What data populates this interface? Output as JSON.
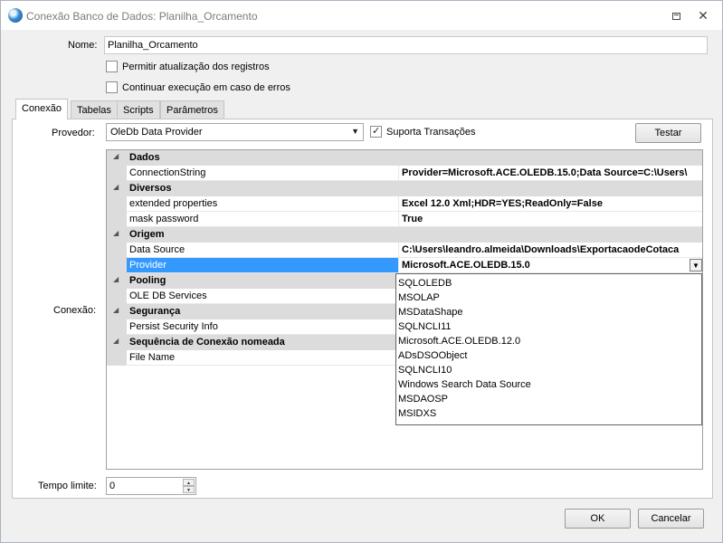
{
  "window": {
    "title": "Conexão Banco de Dados: Planilha_Orcamento",
    "restore_icon": "restore-window-icon",
    "close_glyph": "✕"
  },
  "form": {
    "name_label": "Nome:",
    "name_value": "Planilha_Orcamento",
    "allow_update_label": "Permitir atualização dos registros",
    "allow_update_checked": false,
    "continue_on_error_label": "Continuar execução em caso de erros",
    "continue_on_error_checked": false
  },
  "tabs": [
    {
      "label": "Conexão",
      "active": true
    },
    {
      "label": "Tabelas",
      "active": false
    },
    {
      "label": "Scripts",
      "active": false
    },
    {
      "label": "Parâmetros",
      "active": false
    }
  ],
  "connection": {
    "provider_label": "Provedor:",
    "provider_value": "OleDb Data Provider",
    "supports_transactions_label": "Suporta Transações",
    "supports_transactions_checked": true,
    "test_button": "Testar",
    "connection_label": "Conexão:",
    "timeout_label": "Tempo limite:",
    "timeout_value": "0"
  },
  "grid": {
    "collapse_glyph": "◢",
    "rows": [
      {
        "kind": "category",
        "label": "Dados"
      },
      {
        "kind": "property",
        "name": "ConnectionString",
        "value": "Provider=Microsoft.ACE.OLEDB.15.0;Data Source=C:\\Users\\"
      },
      {
        "kind": "category",
        "label": "Diversos"
      },
      {
        "kind": "property",
        "name": "extended properties",
        "value": "Excel 12.0 Xml;HDR=YES;ReadOnly=False"
      },
      {
        "kind": "property",
        "name": "mask password",
        "value": "True"
      },
      {
        "kind": "category",
        "label": "Origem"
      },
      {
        "kind": "property",
        "name": "Data Source",
        "value": "C:\\Users\\leandro.almeida\\Downloads\\ExportacaodeCotaca"
      },
      {
        "kind": "property",
        "name": "Provider",
        "value": "Microsoft.ACE.OLEDB.15.0",
        "selected": true,
        "dropdown": true
      },
      {
        "kind": "category",
        "label": "Pooling"
      },
      {
        "kind": "property",
        "name": "OLE DB Services",
        "value": ""
      },
      {
        "kind": "category",
        "label": "Segurança"
      },
      {
        "kind": "property",
        "name": "Persist Security Info",
        "value": ""
      },
      {
        "kind": "category",
        "label": "Sequência de Conexão nomeada"
      },
      {
        "kind": "property",
        "name": "File Name",
        "value": ""
      }
    ]
  },
  "provider_dropdown": {
    "items": [
      "SQLOLEDB",
      "MSOLAP",
      "MSDataShape",
      "SQLNCLI11",
      "Microsoft.ACE.OLEDB.12.0",
      "ADsDSOObject",
      "SQLNCLI10",
      "Windows Search Data Source",
      "MSDAOSP",
      "MSIDXS"
    ]
  },
  "footer": {
    "ok_button": "OK",
    "cancel_button": "Cancelar"
  }
}
